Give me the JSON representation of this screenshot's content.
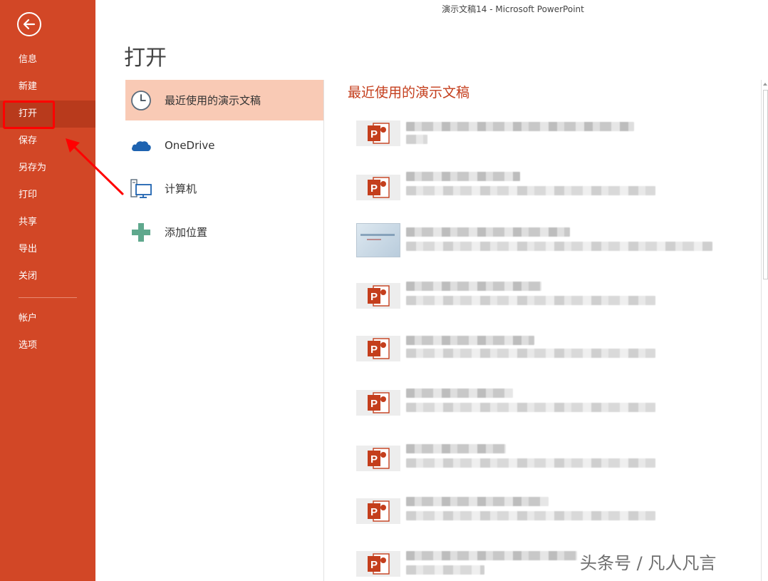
{
  "window_title": "演示文稿14 - Microsoft PowerPoint",
  "sidebar": {
    "back_icon": "back-arrow-icon",
    "items": [
      {
        "label": "信息"
      },
      {
        "label": "新建"
      },
      {
        "label": "打开"
      },
      {
        "label": "保存"
      },
      {
        "label": "另存为"
      },
      {
        "label": "打印"
      },
      {
        "label": "共享"
      },
      {
        "label": "导出"
      },
      {
        "label": "关闭"
      }
    ],
    "bottom_items": [
      {
        "label": "帐户"
      },
      {
        "label": "选项"
      }
    ],
    "selected": "打开"
  },
  "page_title": "打开",
  "locations": [
    {
      "label": "最近使用的演示文稿",
      "icon": "clock-icon"
    },
    {
      "label": "OneDrive",
      "icon": "cloud-icon"
    },
    {
      "label": "计算机",
      "icon": "computer-icon"
    },
    {
      "label": "添加位置",
      "icon": "plus-icon"
    }
  ],
  "recent": {
    "title": "最近使用的演示文稿",
    "file_count": 9
  },
  "watermark": "头条号 / 凡人凡言",
  "colors": {
    "sidebar": "#D24726",
    "sidebar_selected": "#B83A1C",
    "location_selected": "#F9CAB5",
    "accent_text": "#C43E1C",
    "annotation": "#FF0000"
  }
}
